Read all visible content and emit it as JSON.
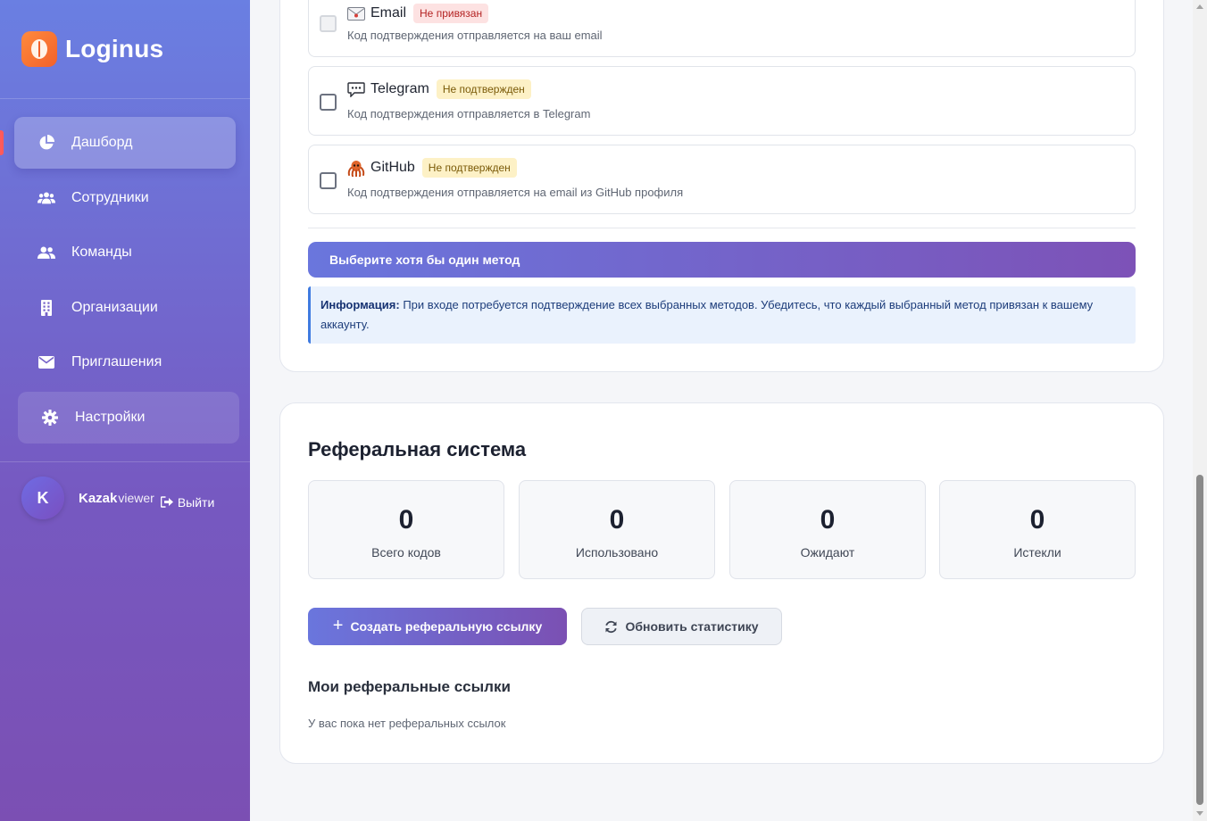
{
  "app": {
    "name": "Loginus"
  },
  "sidebar": {
    "items": [
      {
        "label": "Дашборд",
        "icon": "pie-chart-icon"
      },
      {
        "label": "Сотрудники",
        "icon": "users-icon"
      },
      {
        "label": "Команды",
        "icon": "team-icon"
      },
      {
        "label": "Организации",
        "icon": "building-icon"
      },
      {
        "label": "Приглашения",
        "icon": "envelope-icon"
      },
      {
        "label": "Настройки",
        "icon": "gear-icon"
      }
    ],
    "active_index": 0
  },
  "user": {
    "initial": "K",
    "name": "Kazak",
    "role": "viewer",
    "logout_label": "Выйти"
  },
  "mfa": {
    "methods": [
      {
        "name": "Email",
        "badge": "Не привязан",
        "badge_type": "red",
        "description": "Код подтверждения отправляется на ваш email",
        "checked": false,
        "disabled": true,
        "icon": "mail-icon"
      },
      {
        "name": "Telegram",
        "badge": "Не подтвержден",
        "badge_type": "yellow",
        "description": "Код подтверждения отправляется в Telegram",
        "checked": false,
        "disabled": false,
        "icon": "chat-bubble-icon"
      },
      {
        "name": "GitHub",
        "badge": "Не подтвержден",
        "badge_type": "yellow",
        "description": "Код подтверждения отправляется на email из GitHub профиля",
        "checked": false,
        "disabled": false,
        "icon": "octopus-icon"
      }
    ],
    "submit_label": "Выберите хотя бы один метод",
    "info_label": "Информация:",
    "info_text": "При входе потребуется подтверждение всех выбранных методов. Убедитесь, что каждый выбранный метод привязан к вашему аккаунту."
  },
  "referral": {
    "title": "Реферальная система",
    "stats": [
      {
        "value": "0",
        "label": "Всего кодов"
      },
      {
        "value": "0",
        "label": "Использовано"
      },
      {
        "value": "0",
        "label": "Ожидают"
      },
      {
        "value": "0",
        "label": "Истекли"
      }
    ],
    "create_label": "Создать реферальную ссылку",
    "refresh_label": "Обновить статистику",
    "my_links_title": "Мои реферальные ссылки",
    "empty_text": "У вас пока нет реферальных ссылок"
  },
  "colors": {
    "accent_start": "#6a76dd",
    "accent_end": "#7b50b3",
    "badge_red_bg": "#fde2e2",
    "badge_yellow_bg": "#fdf1c6"
  }
}
